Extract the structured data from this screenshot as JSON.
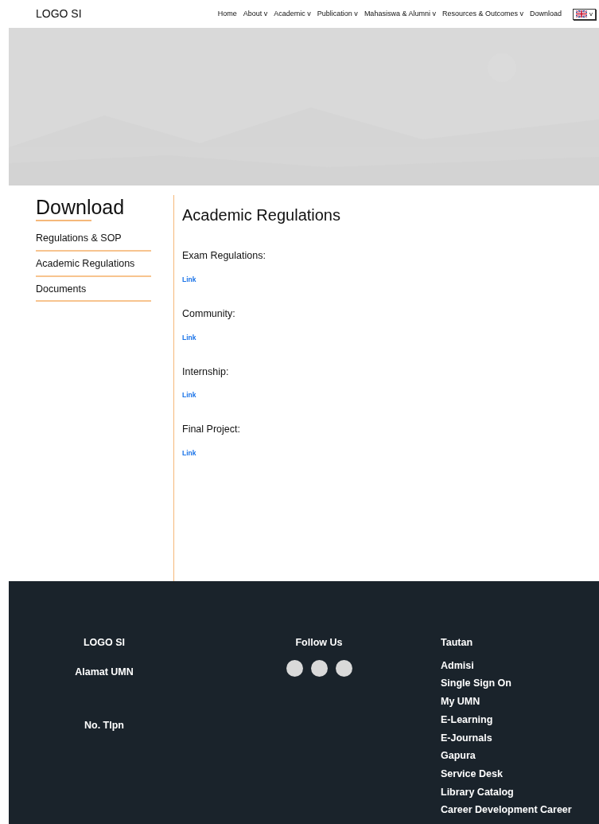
{
  "header": {
    "logo": "LOGO SI",
    "nav": [
      {
        "label": "Home"
      },
      {
        "label": "About",
        "caret": "v"
      },
      {
        "label": "Academic",
        "caret": "v"
      },
      {
        "label": "Publication",
        "caret": "v"
      },
      {
        "label": "Mahasiswa & Alumni",
        "caret": "v"
      },
      {
        "label": "Resources & Outcomes",
        "caret": "v"
      },
      {
        "label": "Download"
      }
    ],
    "language": {
      "caret": "v"
    }
  },
  "sidebar": {
    "title": "Download",
    "items": [
      "Regulations & SOP",
      "Academic Regulations",
      "Documents"
    ]
  },
  "content": {
    "title": "Academic Regulations",
    "sections": [
      {
        "label": "Exam Regulations:",
        "link": "Link"
      },
      {
        "label": "Community:",
        "link": "Link"
      },
      {
        "label": "Internship:",
        "link": "Link"
      },
      {
        "label": "Final Project:",
        "link": "Link"
      }
    ]
  },
  "footer": {
    "logo": "LOGO SI",
    "address": "Alamat UMN",
    "phone": "No. Tlpn",
    "follow_title": "Follow Us",
    "social": [
      {
        "kind": "circle"
      },
      {
        "kind": "circle"
      },
      {
        "kind": "circle"
      }
    ],
    "links_title": "Tautan",
    "links": [
      "Admisi",
      "Single Sign On",
      "My UMN",
      "E-Learning",
      "E-Journals",
      "Gapura",
      "Service Desk",
      "Library Catalog",
      "Career Development Career"
    ]
  }
}
